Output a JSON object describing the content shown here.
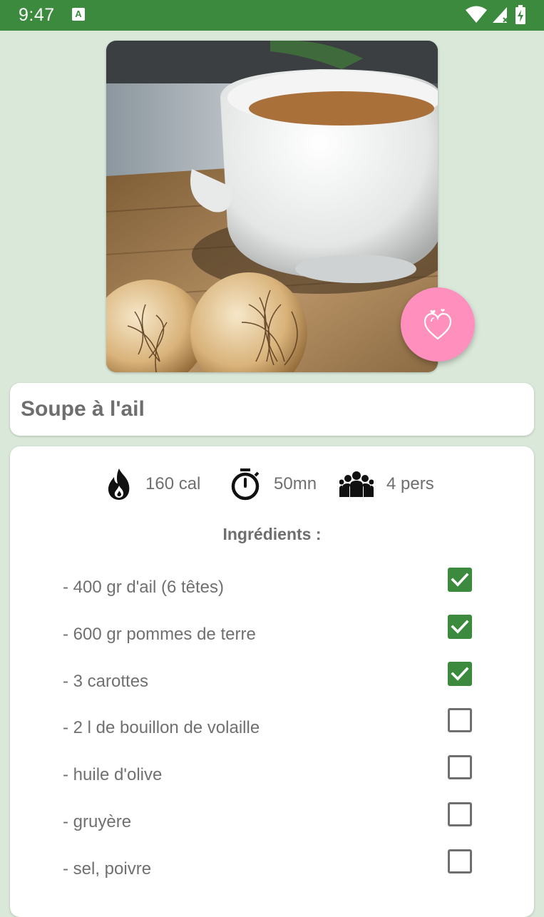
{
  "status_bar": {
    "time": "9:47",
    "notification_icon_letter": "A",
    "icons": [
      "wifi-icon",
      "cell-signal-icon",
      "battery-charging-icon"
    ]
  },
  "colors": {
    "status_bar": "#3b8a3e",
    "background": "#d9e8d9",
    "fab": "#ff90be",
    "checkbox_checked": "#3b8a3e"
  },
  "recipe": {
    "title": "Soupe à l'ail",
    "photo_icon": "garlic-soup-photo",
    "favorite_icon": "heart-icon",
    "stats": {
      "calories": "160 cal",
      "duration": "50mn",
      "servings": "4 pers"
    },
    "ingredients_heading": "Ingrédients :",
    "ingredients": [
      {
        "label": "- 400 gr d'ail (6 têtes)",
        "checked": true
      },
      {
        "label": "- 600 gr pommes de terre",
        "checked": true
      },
      {
        "label": "- 3 carottes",
        "checked": true
      },
      {
        "label": "- 2 l de bouillon de volaille",
        "checked": false
      },
      {
        "label": "- huile d'olive",
        "checked": false
      },
      {
        "label": "- gruyère",
        "checked": false
      },
      {
        "label": "- sel, poivre",
        "checked": false
      }
    ]
  }
}
